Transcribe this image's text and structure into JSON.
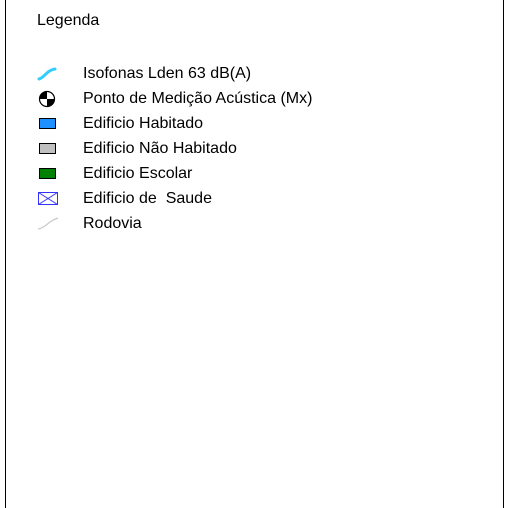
{
  "legend": {
    "title": "Legenda",
    "items": [
      {
        "label": "Isofonas Lden 63 dB(A)",
        "icon": "isophone-line-icon",
        "color": "#33ccff"
      },
      {
        "label": "Ponto de Medição Acústica (Mx)",
        "icon": "measurement-point-icon",
        "color": "#000000"
      },
      {
        "label": "Edificio Habitado",
        "icon": "inhabited-building-swatch-icon",
        "color": "#1e90ff"
      },
      {
        "label": "Edificio Não Habitado",
        "icon": "uninhabited-building-swatch-icon",
        "color": "#c0c0c0"
      },
      {
        "label": "Edificio Escolar",
        "icon": "school-building-swatch-icon",
        "color": "#008000"
      },
      {
        "label": "Edificio de  Saude",
        "icon": "health-building-swatch-icon",
        "color": "#3333ff"
      },
      {
        "label": "Rodovia",
        "icon": "road-line-icon",
        "color": "#c8c8c8"
      }
    ]
  }
}
